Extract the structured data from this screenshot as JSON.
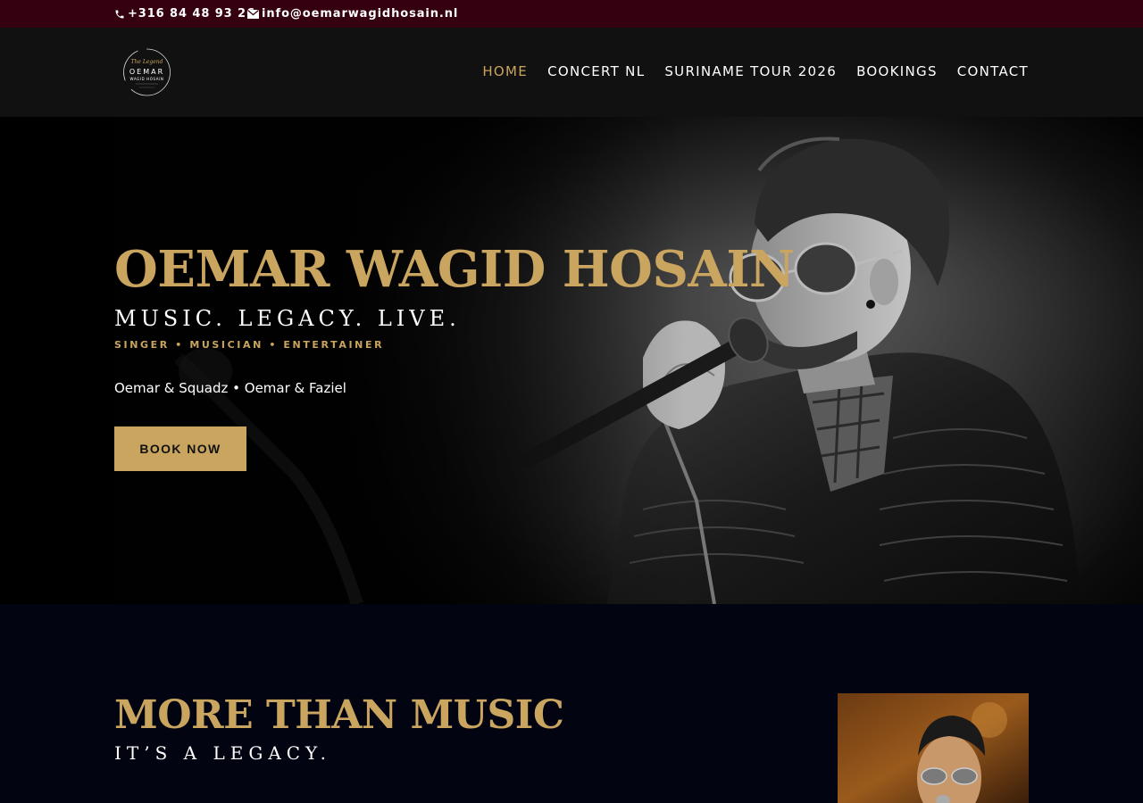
{
  "topbar": {
    "phone": "+316 84 48 93 26",
    "email": "info@oemarwagidhosain.nl",
    "background": "#350010"
  },
  "header": {
    "logo": {
      "line1": "The Legend",
      "line2": "OEMAR",
      "line3": "WAGID HOSAIN"
    },
    "nav": [
      {
        "label": "HOME",
        "active": true
      },
      {
        "label": "CONCERT NL",
        "active": false
      },
      {
        "label": "SURINAME TOUR 2026",
        "active": false
      },
      {
        "label": "BOOKINGS",
        "active": false
      },
      {
        "label": "CONTACT",
        "active": false
      }
    ]
  },
  "hero": {
    "title": "OEMAR WAGID HOSAIN",
    "tagline": "MUSIC. LEGACY. LIVE.",
    "roles": "SINGER • MUSICIAN • ENTERTAINER",
    "groups": "Oemar & Squadz • Oemar & Faziel",
    "cta": "BOOK NOW"
  },
  "section2": {
    "title": "MORE THAN MUSIC",
    "subtitle": "IT’S A LEGACY."
  },
  "colors": {
    "accent": "#c9a55f",
    "header": "#111111",
    "section_bg": "#030412"
  }
}
